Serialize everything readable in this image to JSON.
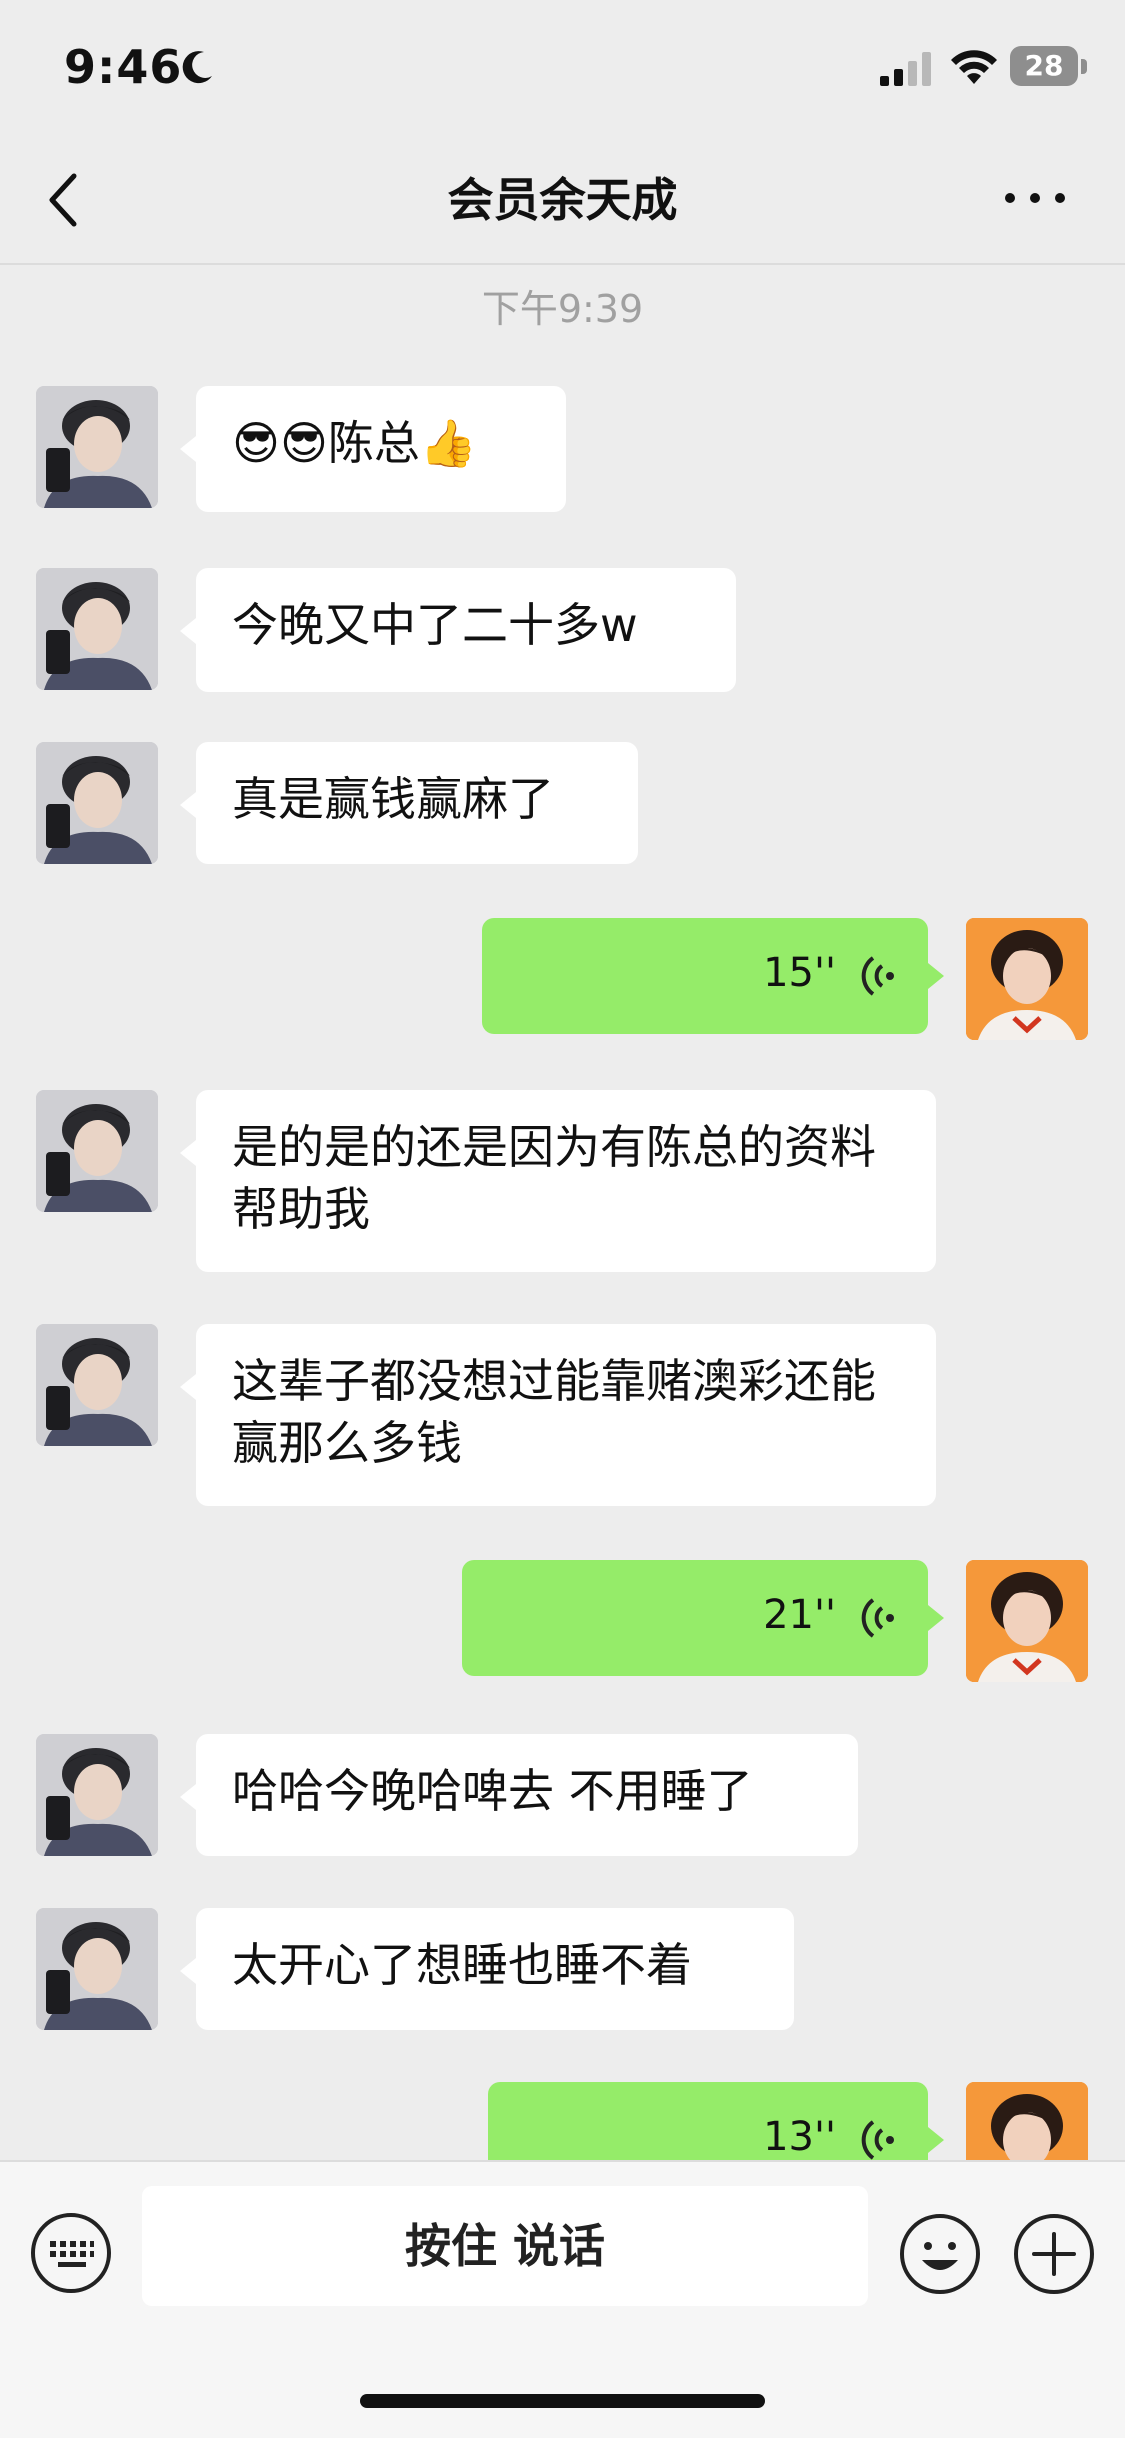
{
  "status_bar": {
    "time": "9:46",
    "battery": "28",
    "moon_icon": "moon-icon",
    "signal_icon": "cellular-signal-icon",
    "wifi_icon": "wifi-icon"
  },
  "nav": {
    "title": "会员余天成",
    "back_icon": "chevron-left-icon",
    "more_icon": "more-dots-icon"
  },
  "timestamp": "下午9:39",
  "messages": [
    {
      "from": "them",
      "text": "😎😎陈总👍"
    },
    {
      "from": "them",
      "text": "今晚又中了二十多w"
    },
    {
      "from": "them",
      "text": "真是赢钱赢麻了"
    },
    {
      "from": "me",
      "type": "voice",
      "duration": "15''"
    },
    {
      "from": "them",
      "text": "是的是的还是因为有陈总的资料帮助我"
    },
    {
      "from": "them",
      "text": "这辈子都没想过能靠赌澳彩还能赢那么多钱"
    },
    {
      "from": "me",
      "type": "voice",
      "duration": "21''"
    },
    {
      "from": "them",
      "text": "哈哈今晚哈啤去 不用睡了"
    },
    {
      "from": "them",
      "text": "太开心了想睡也睡不着"
    },
    {
      "from": "me",
      "type": "voice",
      "duration": "13''"
    }
  ],
  "input_bar": {
    "hold_to_talk": "按住 说话",
    "keyboard_icon": "keyboard-icon",
    "emoji_icon": "emoji-icon",
    "plus_icon": "plus-icon"
  },
  "colors": {
    "background": "#ededed",
    "sent_bubble": "#95ec69",
    "received_bubble": "#ffffff"
  }
}
